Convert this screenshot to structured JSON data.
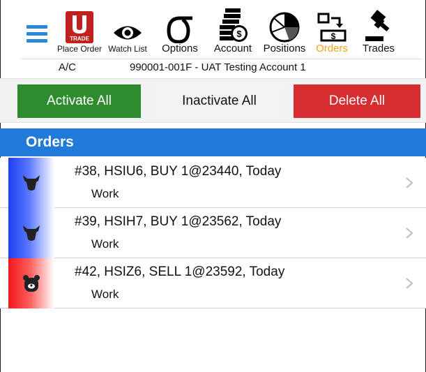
{
  "toolbar": {
    "items": [
      {
        "label": "Place Order",
        "icon": "utrade-logo-icon",
        "logo_text": "TRADE"
      },
      {
        "label": "Watch List",
        "icon": "eye-icon"
      },
      {
        "label": "Options",
        "icon": "sigma-icon"
      },
      {
        "label": "Account",
        "icon": "coins-icon"
      },
      {
        "label": "Positions",
        "icon": "pie-chart-icon"
      },
      {
        "label": "Orders",
        "icon": "orders-icon",
        "active": true
      },
      {
        "label": "Trades",
        "icon": "gavel-icon"
      }
    ],
    "active_color": "#f2a21a",
    "menu_color": "#2c87d8"
  },
  "account": {
    "label": "A/C",
    "value": "990001-001F - UAT Testing Account 1"
  },
  "actions": {
    "activate_all": "Activate All",
    "inactivate_all": "Inactivate All",
    "delete_all": "Delete All"
  },
  "colors": {
    "activate": "#2e8b2e",
    "delete": "#d62e2e",
    "header": "#1f7ad8"
  },
  "orders": {
    "title": "Orders",
    "items": [
      {
        "title": "#38, HSIU6, BUY 1@23440, Today",
        "status": "Work",
        "side": "buy"
      },
      {
        "title": "#39, HSIH7, BUY 1@23562, Today",
        "status": "Work",
        "side": "buy"
      },
      {
        "title": "#42, HSIZ6, SELL 1@23592, Today",
        "status": "Work",
        "side": "sell"
      }
    ]
  }
}
